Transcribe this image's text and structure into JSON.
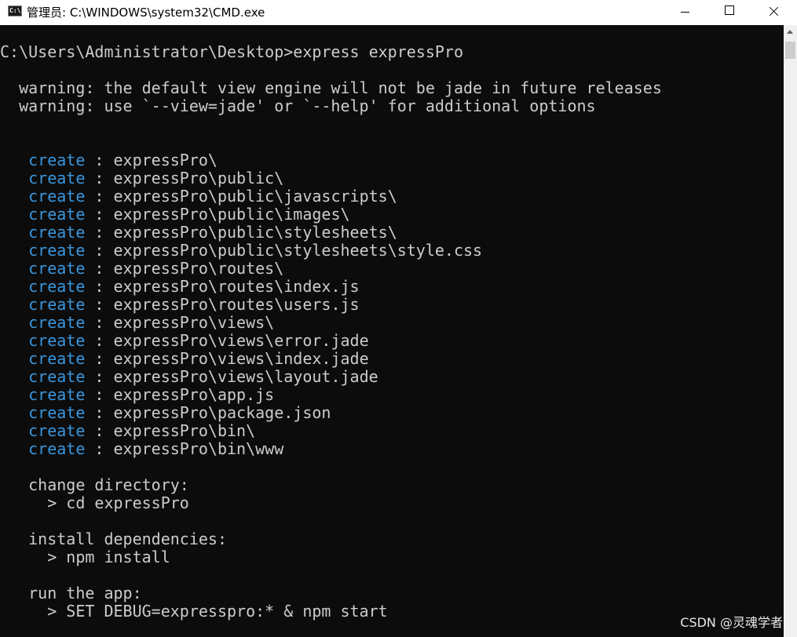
{
  "window": {
    "title": "管理员: C:\\WINDOWS\\system32\\CMD.exe"
  },
  "console": {
    "prompt": "C:\\Users\\Administrator\\Desktop>express expressPro",
    "warnings": [
      "  warning: the default view engine will not be jade in future releases",
      "  warning: use `--view=jade' or `--help' for additional options"
    ],
    "create_keyword": "create",
    "created": [
      " : expressPro\\",
      " : expressPro\\public\\",
      " : expressPro\\public\\javascripts\\",
      " : expressPro\\public\\images\\",
      " : expressPro\\public\\stylesheets\\",
      " : expressPro\\public\\stylesheets\\style.css",
      " : expressPro\\routes\\",
      " : expressPro\\routes\\index.js",
      " : expressPro\\routes\\users.js",
      " : expressPro\\views\\",
      " : expressPro\\views\\error.jade",
      " : expressPro\\views\\index.jade",
      " : expressPro\\views\\layout.jade",
      " : expressPro\\app.js",
      " : expressPro\\package.json",
      " : expressPro\\bin\\",
      " : expressPro\\bin\\www"
    ],
    "instructions": [
      "   change directory:",
      "     > cd expressPro",
      "   install dependencies:",
      "     > npm install",
      "   run the app:",
      "     > SET DEBUG=expresspro:* & npm start"
    ]
  },
  "watermark": "CSDN @灵魂学者",
  "colors": {
    "background": "#0c0c0c",
    "text": "#cccccc",
    "keyword": "#3a96dd"
  },
  "icons": [
    "cmd-app-icon",
    "minimize-icon",
    "maximize-icon",
    "close-icon",
    "scroll-up-arrow-icon"
  ]
}
